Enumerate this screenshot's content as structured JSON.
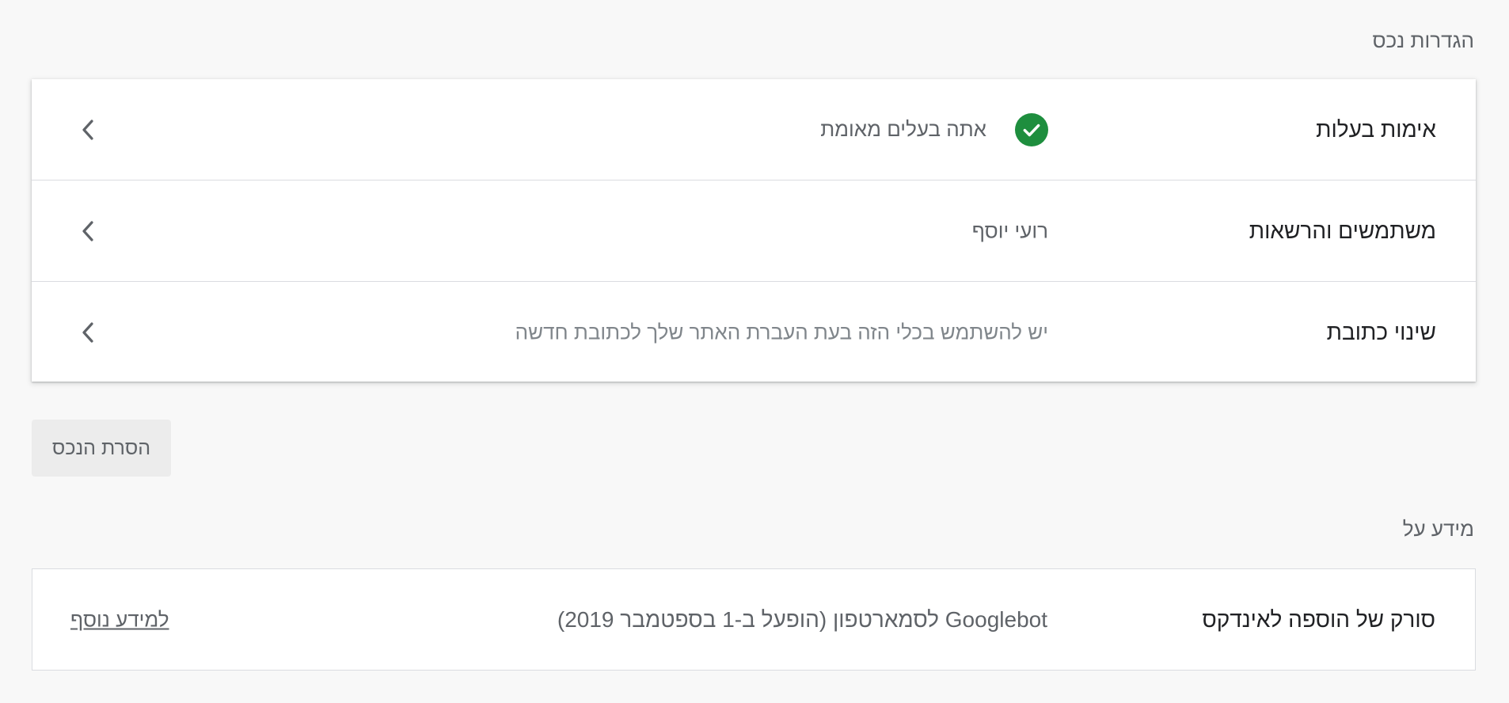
{
  "settings_section": {
    "title": "הגדרות נכס",
    "rows": [
      {
        "label": "אימות בעלות",
        "value": "אתה בעלים מאומת",
        "status_icon": "check-circle-icon",
        "status_color": "#1e8e3e"
      },
      {
        "label": "משתמשים והרשאות",
        "value": "רועי יוסף"
      },
      {
        "label": "שינוי כתובת",
        "value": "יש להשתמש בכלי הזה בעת העברת האתר שלך לכתובת חדשה"
      }
    ],
    "row_icon": "chevron-left-icon"
  },
  "remove_button": {
    "label": "הסרת הנכס"
  },
  "info_section": {
    "title": "מידע על",
    "rows": [
      {
        "label": "סורק של הוספה לאינדקס",
        "value": "Googlebot לסמארטפון (הופעל ב-1 בספטמבר 2019)",
        "link": "למידע נוסף"
      }
    ]
  }
}
